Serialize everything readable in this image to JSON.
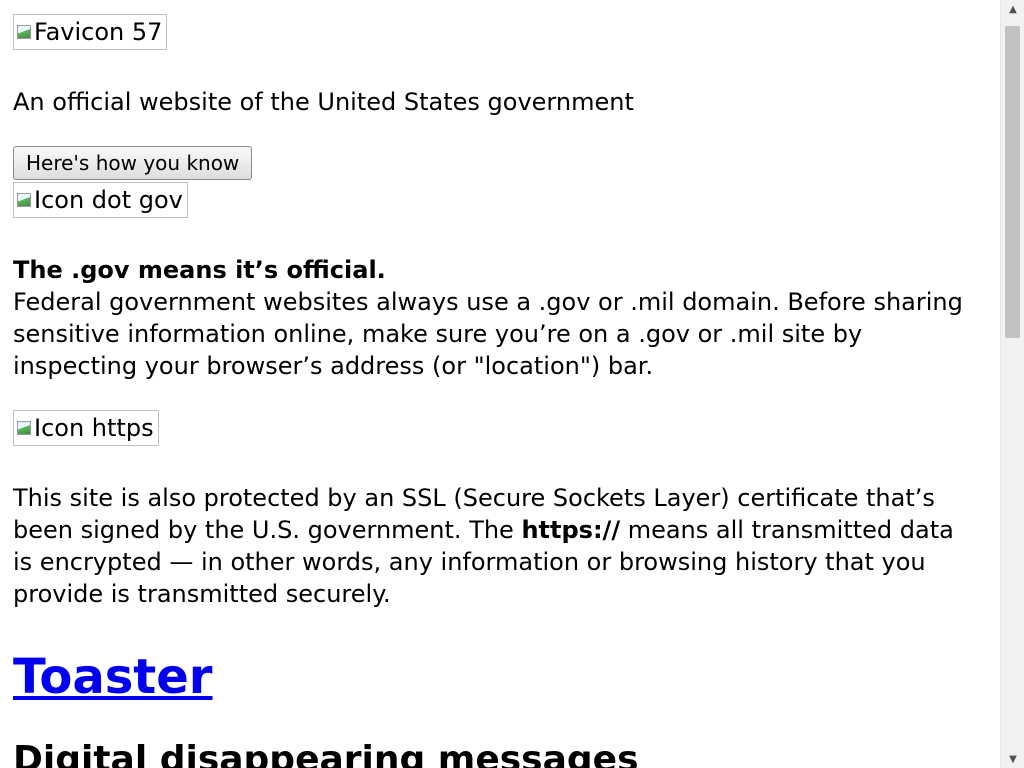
{
  "banner": {
    "favicon_alt": "Favicon 57",
    "official_text": "An official website of the United States government",
    "how_button_label": "Here's how you know",
    "dotgov_icon_alt": "Icon dot gov",
    "gov_heading": "The .gov means it’s official.",
    "gov_body": "Federal government websites always use a .gov or .mil domain. Before sharing sensitive information online, make sure you’re on a .gov or .mil site by inspecting your browser’s address (or \"location\") bar.",
    "https_icon_alt": "Icon https",
    "ssl_before": "This site is also protected by an SSL (Secure Sockets Layer) certificate that’s been signed by the U.S. government. The ",
    "ssl_bold": "https://",
    "ssl_after": " means all transmitted data is encrypted — in other words, any information or browsing history that you provide is transmitted securely."
  },
  "main": {
    "title_link": "Toaster",
    "subtitle": "Digital disappearing messages"
  },
  "scrollbar": {
    "up_icon": "arrow-up-icon",
    "down_icon": "arrow-down-icon"
  },
  "colors": {
    "link": "#0000ee",
    "scroll_thumb": "#c1c1c1"
  }
}
